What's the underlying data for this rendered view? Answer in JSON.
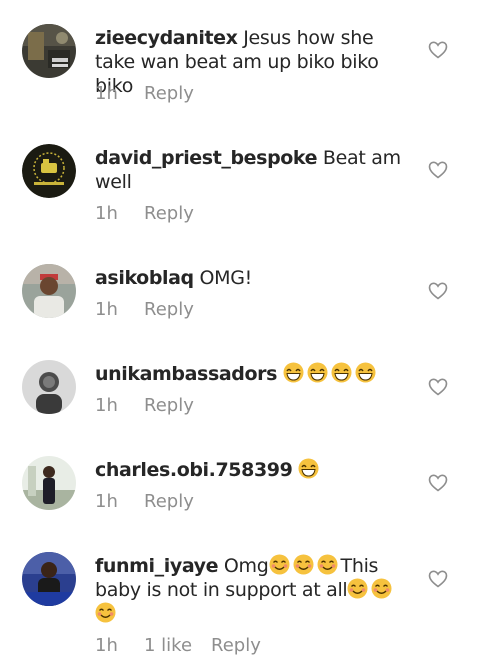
{
  "comments": [
    {
      "username": "zieecydanitex",
      "text": "Jesus how she take wan beat am up biko biko biko",
      "time": "1h",
      "likes": "",
      "reply": "Reply",
      "avatar_icon": "avatar-photo",
      "emoji_count": 0
    },
    {
      "username": "david_priest_bespoke",
      "text": "Beat am well",
      "time": "1h",
      "likes": "",
      "reply": "Reply",
      "avatar_icon": "avatar-logo",
      "emoji_count": 0
    },
    {
      "username": "asikoblaq",
      "text": "OMG!",
      "time": "1h",
      "likes": "",
      "reply": "Reply",
      "avatar_icon": "avatar-photo",
      "emoji_count": 0
    },
    {
      "username": "unikambassadors",
      "text": "",
      "time": "1h",
      "likes": "",
      "reply": "Reply",
      "avatar_icon": "avatar-photo",
      "emoji_count": 4
    },
    {
      "username": "charles.obi.758399",
      "text": "",
      "time": "1h",
      "likes": "",
      "reply": "Reply",
      "avatar_icon": "avatar-photo",
      "emoji_count": 1
    },
    {
      "username": "funmi_iyaye",
      "text_a": "Omg",
      "text_b": "This baby is not in support at all",
      "time": "1h",
      "likes": "1 like",
      "reply": "Reply",
      "avatar_icon": "avatar-photo",
      "emoji_count": 6
    }
  ],
  "icons": {
    "like": "heart-outline-icon",
    "emoji_grin": "grinning-face-emoji",
    "emoji_smile": "smiling-face-emoji"
  },
  "colors": {
    "text": "#262626",
    "meta": "#8e8e8e",
    "emoji": "#f6c23e"
  }
}
